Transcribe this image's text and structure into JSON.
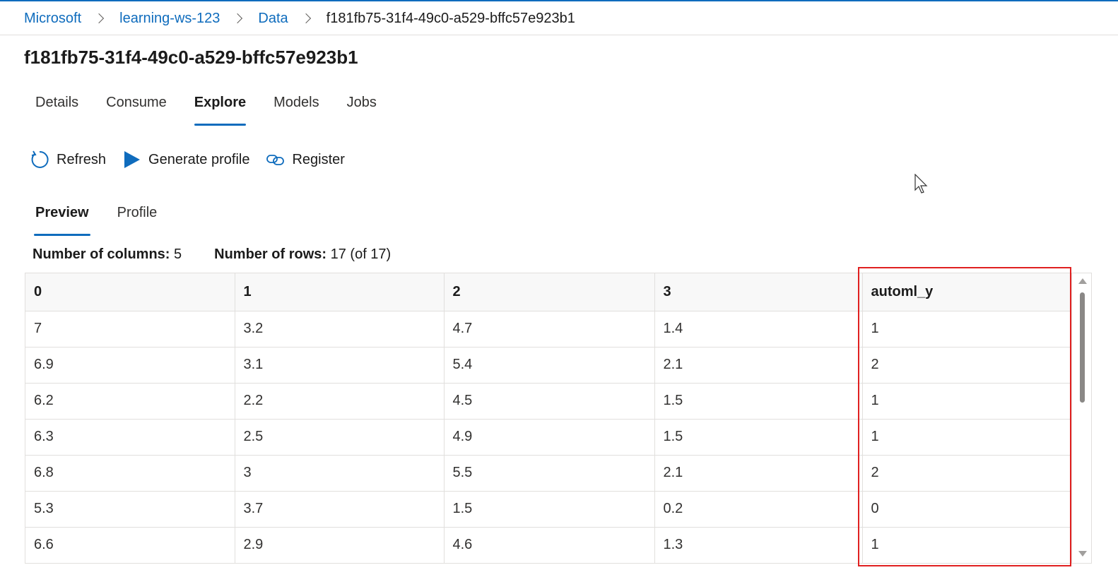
{
  "breadcrumb": {
    "items": [
      "Microsoft",
      "learning-ws-123",
      "Data"
    ],
    "current": "f181fb75-31f4-49c0-a529-bffc57e923b1"
  },
  "page": {
    "title": "f181fb75-31f4-49c0-a529-bffc57e923b1"
  },
  "tabs": [
    {
      "label": "Details",
      "active": false
    },
    {
      "label": "Consume",
      "active": false
    },
    {
      "label": "Explore",
      "active": true
    },
    {
      "label": "Models",
      "active": false
    },
    {
      "label": "Jobs",
      "active": false
    }
  ],
  "toolbar": {
    "refresh_label": "Refresh",
    "refresh_icon": "refresh-icon",
    "generate_profile_label": "Generate profile",
    "generate_profile_icon": "play-icon",
    "register_label": "Register",
    "register_icon": "link-icon"
  },
  "subtabs": [
    {
      "label": "Preview",
      "active": true
    },
    {
      "label": "Profile",
      "active": false
    }
  ],
  "counts": {
    "columns_label": "Number of columns:",
    "columns_value": "5",
    "rows_label": "Number of rows:",
    "rows_value": "17 (of 17)"
  },
  "grid": {
    "columns": [
      "0",
      "1",
      "2",
      "3",
      "automl_y"
    ],
    "rows": [
      [
        "7",
        "3.2",
        "4.7",
        "1.4",
        "1"
      ],
      [
        "6.9",
        "3.1",
        "5.4",
        "2.1",
        "2"
      ],
      [
        "6.2",
        "2.2",
        "4.5",
        "1.5",
        "1"
      ],
      [
        "6.3",
        "2.5",
        "4.9",
        "1.5",
        "1"
      ],
      [
        "6.8",
        "3",
        "5.5",
        "2.1",
        "2"
      ],
      [
        "5.3",
        "3.7",
        "1.5",
        "0.2",
        "0"
      ],
      [
        "6.6",
        "2.9",
        "4.6",
        "1.3",
        "1"
      ]
    ]
  },
  "colors": {
    "accent": "#0f6cbd",
    "highlight": "#e02020"
  }
}
